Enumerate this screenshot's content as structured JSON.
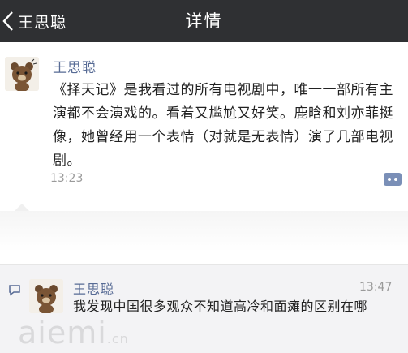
{
  "navbar": {
    "back_label": "王思聪",
    "title": "详情"
  },
  "post": {
    "author": "王思聪",
    "text": "《择天记》是我看过的所有电视剧中，唯一一部所有主演都不会演戏的。看着又尴尬又好笑。鹿晗和刘亦菲挺像，她曾经用一个表情（对就是无表情）演了几部电视剧。",
    "time": "13:23"
  },
  "comment": {
    "author": "王思聪",
    "time": "13:47",
    "text": "我发现中国很多观众不知道高冷和面瘫的区别在哪"
  },
  "watermark": {
    "text": "aiemi",
    "suffix": ".cn"
  },
  "colors": {
    "navbar_bg": "#2f3033",
    "link": "#576b95",
    "comment_panel_bg": "#f3f3f5"
  },
  "icons": [
    "chevron-left-icon",
    "comment-action-icon",
    "comment-bubble-icon",
    "bear-avatar"
  ]
}
